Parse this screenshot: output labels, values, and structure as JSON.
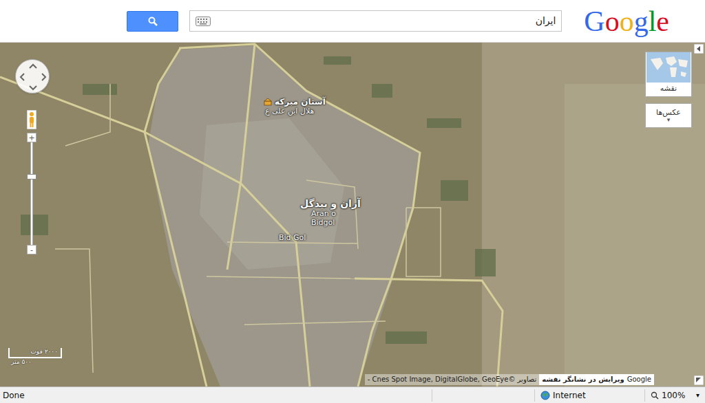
{
  "header": {
    "logo": [
      {
        "char": "G",
        "color": "#3369e8"
      },
      {
        "char": "o",
        "color": "#d50f25"
      },
      {
        "char": "o",
        "color": "#eeb211"
      },
      {
        "char": "g",
        "color": "#3369e8"
      },
      {
        "char": "l",
        "color": "#009925"
      },
      {
        "char": "e",
        "color": "#d50f25"
      }
    ],
    "search": {
      "value": "ایران"
    }
  },
  "map": {
    "labels": [
      {
        "text": "آستان مبرکه",
        "kind": "place"
      },
      {
        "text": "هلال ابن علی ع",
        "kind": "place-sub"
      },
      {
        "text": "آران و بیدگل",
        "kind": "city"
      },
      {
        "text": "Aran o",
        "kind": "city-latin"
      },
      {
        "text": "Bidgol",
        "kind": "city-latin"
      },
      {
        "text": "Bid Gol",
        "kind": "district"
      }
    ],
    "zoom": {
      "level": 0.69,
      "plus": "+",
      "minus": "-"
    },
    "map_type": {
      "label": "نقشه"
    },
    "photos": {
      "label": "عکس‌ها",
      "arrow": "▾"
    },
    "scale": {
      "top": "۲۰۰۰ فوت",
      "bottom": "۵۰۰ متر"
    },
    "attribution": "تصاویر ©Cnes Spot Image, DigitalGlobe, GeoEye -",
    "edit_link": "ویرایش در نشانگر نقشه",
    "brand": "Google"
  },
  "status_bar": {
    "left": "Done",
    "zone": "Internet",
    "zoom": "100%",
    "zoom_arrow": "▾"
  }
}
